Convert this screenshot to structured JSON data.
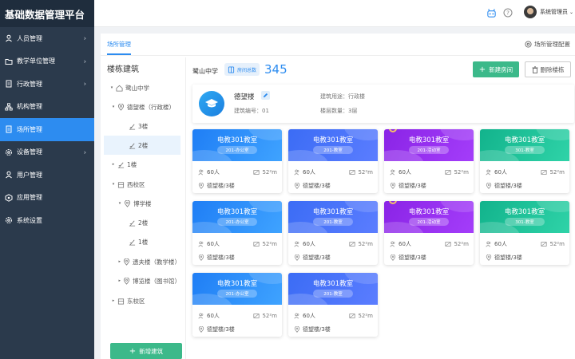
{
  "app": {
    "title": "基础数据管理平台"
  },
  "sidebar": {
    "items": [
      {
        "label": "人员管理",
        "icon": "person-icon",
        "has_children": true,
        "active": false
      },
      {
        "label": "教学单位管理",
        "icon": "folder-icon",
        "has_children": true,
        "active": false
      },
      {
        "label": "行政管理",
        "icon": "doc-icon",
        "has_children": true,
        "active": false
      },
      {
        "label": "机构管理",
        "icon": "org-icon",
        "has_children": false,
        "active": false
      },
      {
        "label": "场所管理",
        "icon": "doc-icon",
        "has_children": false,
        "active": true
      },
      {
        "label": "设备管理",
        "icon": "gear-icon",
        "has_children": true,
        "active": false
      },
      {
        "label": "用户管理",
        "icon": "person-icon",
        "has_children": false,
        "active": false
      },
      {
        "label": "应用管理",
        "icon": "app-icon",
        "has_children": false,
        "active": false
      },
      {
        "label": "系统设置",
        "icon": "gear-icon",
        "has_children": false,
        "active": false
      }
    ]
  },
  "topbar": {
    "user_name": "系统管理员"
  },
  "tabs": {
    "active": "场所管理",
    "config": "场所管理配置"
  },
  "tree": {
    "title": "楼栋建筑",
    "nodes": [
      {
        "label": "鹭山中学",
        "arrow": "▾",
        "icon": "home-icon"
      },
      {
        "label": "德望楼（行政楼）",
        "arrow": "▾",
        "icon": "pin-icon"
      },
      {
        "label": "3楼",
        "arrow": "",
        "icon": "floor-icon"
      },
      {
        "label": "2楼",
        "arrow": "",
        "icon": "floor-icon",
        "selected": true
      },
      {
        "label": "1楼",
        "arrow": "▸",
        "icon": "floor-icon"
      },
      {
        "label": "西校区",
        "arrow": "▾",
        "icon": "building-icon"
      },
      {
        "label": "博学楼",
        "arrow": "▾",
        "icon": "pin-icon"
      },
      {
        "label": "2楼",
        "arrow": "",
        "icon": "floor-icon"
      },
      {
        "label": "1楼",
        "arrow": "",
        "icon": "floor-icon"
      },
      {
        "label": "遗夫楼（教学楼）",
        "arrow": "▸",
        "icon": "pin-icon"
      },
      {
        "label": "博览楼（图书馆）",
        "arrow": "▸",
        "icon": "pin-icon"
      },
      {
        "label": "东校区",
        "arrow": "▸",
        "icon": "building-icon"
      }
    ],
    "add_button": "新增建筑"
  },
  "main": {
    "school": "鹭山中学",
    "count_label": "房间总数",
    "count_value": "345",
    "new_room_button": "新建房间",
    "delete_building_button": "删除楼栋"
  },
  "building": {
    "name": "德望楼",
    "code": "建筑编号：01",
    "use": "建筑用途：行政楼",
    "floors": "楼层数量：3层"
  },
  "colors": {
    "accent": "#2d8cf0",
    "green": "#3cb98a",
    "sidebar": "#2b3a4c",
    "card_blue": "#3d86f5",
    "card_purple": "#8c2de8",
    "card_teal": "#1dbf98"
  },
  "rooms": [
    {
      "name": "电教301教室",
      "tag": "201-办公室",
      "capacity": "60人",
      "area": "52²m",
      "location": "德望楼/3楼",
      "theme": "blue"
    },
    {
      "name": "电教301教室",
      "tag": "201-教室",
      "capacity": "60人",
      "area": "52²m",
      "location": "德望楼/3楼",
      "theme": "indigo"
    },
    {
      "name": "电教301教室",
      "tag": "201-活动室",
      "capacity": "60人",
      "area": "52²m",
      "location": "德望楼/3楼",
      "theme": "purple"
    },
    {
      "name": "电教301教室",
      "tag": "301-教室",
      "capacity": "60人",
      "area": "52²m",
      "location": "德望楼/3楼",
      "theme": "teal"
    },
    {
      "name": "电教301教室",
      "tag": "201-办公室",
      "capacity": "60人",
      "area": "52²m",
      "location": "德望楼/3楼",
      "theme": "blue"
    },
    {
      "name": "电教301教室",
      "tag": "201-教室",
      "capacity": "60人",
      "area": "52²m",
      "location": "德望楼/3楼",
      "theme": "indigo"
    },
    {
      "name": "电教301教室",
      "tag": "201-活动室",
      "capacity": "60人",
      "area": "52²m",
      "location": "德望楼/3楼",
      "theme": "purple"
    },
    {
      "name": "电教301教室",
      "tag": "301-教室",
      "capacity": "60人",
      "area": "52²m",
      "location": "德望楼/3楼",
      "theme": "teal"
    },
    {
      "name": "电教301教室",
      "tag": "201-办公室",
      "capacity": "60人",
      "area": "52²m",
      "location": "德望楼/3楼",
      "theme": "blue"
    },
    {
      "name": "电教301教室",
      "tag": "201-教室",
      "capacity": "60人",
      "area": "52²m",
      "location": "德望楼/3楼",
      "theme": "indigo"
    }
  ]
}
